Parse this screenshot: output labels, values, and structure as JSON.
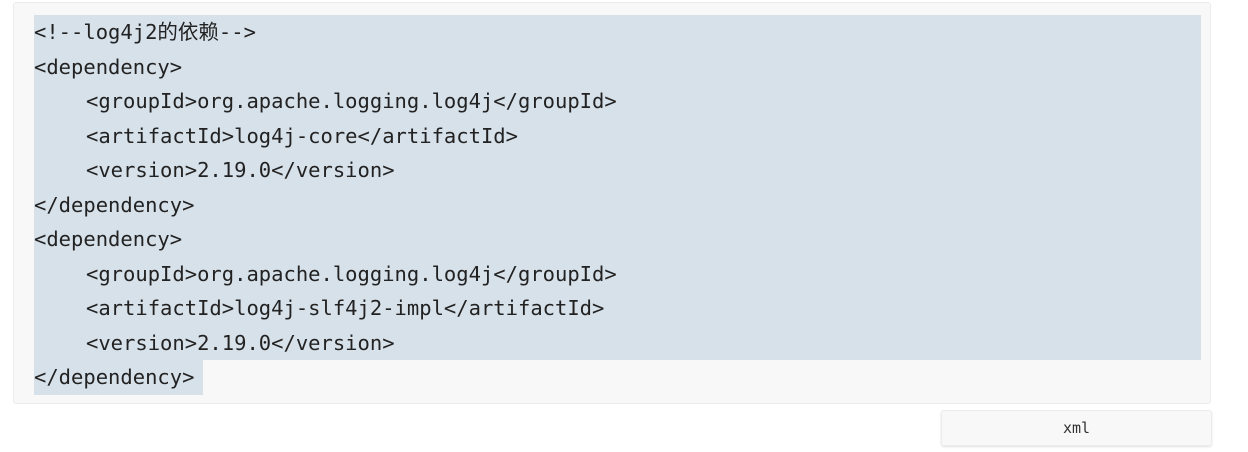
{
  "code_block": {
    "lines": [
      {
        "indent": 0,
        "text": "<!--log4j2的依赖-->"
      },
      {
        "indent": 0,
        "text": "<dependency>"
      },
      {
        "indent": 1,
        "text": "<groupId>org.apache.logging.log4j</groupId>"
      },
      {
        "indent": 1,
        "text": "<artifactId>log4j-core</artifactId>"
      },
      {
        "indent": 1,
        "text": "<version>2.19.0</version>"
      },
      {
        "indent": 0,
        "text": "</dependency>"
      },
      {
        "indent": 0,
        "text": "<dependency>"
      },
      {
        "indent": 1,
        "text": "<groupId>org.apache.logging.log4j</groupId>"
      },
      {
        "indent": 1,
        "text": "<artifactId>log4j-slf4j2-impl</artifactId>"
      },
      {
        "indent": 1,
        "text": "<version>2.19.0</version>"
      },
      {
        "indent": 0,
        "text": "</dependency>"
      }
    ]
  },
  "language_tab": {
    "label": "xml"
  },
  "colors": {
    "selection": "#d7e1ea",
    "code_background": "#f8f8f8",
    "text": "#222222"
  }
}
